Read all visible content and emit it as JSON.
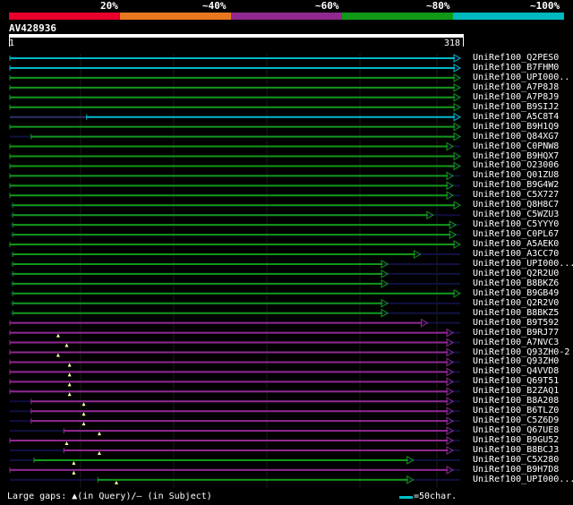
{
  "legend": {
    "labels": [
      "20%",
      "~40%",
      "~60%",
      "~80%",
      "~100%"
    ],
    "colors": [
      "#e8002a",
      "#e87820",
      "#902890",
      "#109818",
      "#00b8c0"
    ]
  },
  "query": {
    "id": "AV428936",
    "start": "1",
    "end": "318",
    "length": 318
  },
  "colors": {
    "cyan": "#00b8c8",
    "green": "#109818",
    "purple": "#902890",
    "navy": "#101040",
    "gap_marker": "#ffffa0"
  },
  "hits": [
    {
      "name": "UniRef100_Q2PES0",
      "color": "cyan",
      "start": 1,
      "end": 318,
      "arrow": true
    },
    {
      "name": "UniRef100_B7FHM0",
      "color": "cyan",
      "start": 1,
      "end": 318,
      "arrow": true
    },
    {
      "name": "UniRef100_UPI000..",
      "color": "green",
      "start": 1,
      "end": 318,
      "arrow": true
    },
    {
      "name": "UniRef100_A7P8J8",
      "color": "green",
      "start": 1,
      "end": 318,
      "arrow": true
    },
    {
      "name": "UniRef100_A7P8J9",
      "color": "green",
      "start": 1,
      "end": 318,
      "arrow": true
    },
    {
      "name": "UniRef100_B9SIJ2",
      "color": "green",
      "start": 1,
      "end": 318,
      "arrow": true
    },
    {
      "name": "UniRef100_A5C8T4",
      "color": "cyan",
      "start": 55,
      "end": 318,
      "arrow": true,
      "prefix": true
    },
    {
      "name": "UniRef100_B9H1Q9",
      "color": "green",
      "start": 1,
      "end": 318,
      "arrow": true
    },
    {
      "name": "UniRef100_Q84XG7",
      "color": "green",
      "start": 16,
      "end": 318,
      "arrow": true
    },
    {
      "name": "UniRef100_C0PNW8",
      "color": "green",
      "start": 1,
      "end": 313,
      "arrow": true
    },
    {
      "name": "UniRef100_B9HQX7",
      "color": "green",
      "start": 1,
      "end": 318,
      "arrow": true
    },
    {
      "name": "UniRef100_O23006",
      "color": "green",
      "start": 1,
      "end": 318,
      "arrow": true
    },
    {
      "name": "UniRef100_Q01ZU8",
      "color": "green",
      "start": 1,
      "end": 313,
      "arrow": true
    },
    {
      "name": "UniRef100_B9G4W2",
      "color": "green",
      "start": 1,
      "end": 313,
      "arrow": true
    },
    {
      "name": "UniRef100_C5X727",
      "color": "green",
      "start": 1,
      "end": 313,
      "arrow": true
    },
    {
      "name": "UniRef100_Q8H8C7",
      "color": "green",
      "start": 3,
      "end": 318,
      "arrow": true
    },
    {
      "name": "UniRef100_C5WZU3",
      "color": "green",
      "start": 3,
      "end": 299,
      "arrow": true
    },
    {
      "name": "UniRef100_C5YYY0",
      "color": "green",
      "start": 3,
      "end": 315,
      "arrow": true
    },
    {
      "name": "UniRef100_C0PL67",
      "color": "green",
      "start": 3,
      "end": 315,
      "arrow": true
    },
    {
      "name": "UniRef100_A5AEK0",
      "color": "green",
      "start": 1,
      "end": 318,
      "arrow": true
    },
    {
      "name": "UniRef100_A3CC70",
      "color": "green",
      "start": 3,
      "end": 290,
      "arrow": true
    },
    {
      "name": "UniRef100_UPI000...",
      "color": "green",
      "start": 3,
      "end": 267,
      "arrow": true
    },
    {
      "name": "UniRef100_Q2R2U0",
      "color": "green",
      "start": 3,
      "end": 267,
      "arrow": true
    },
    {
      "name": "UniRef100_B8BKZ6",
      "color": "green",
      "start": 3,
      "end": 267,
      "arrow": true
    },
    {
      "name": "UniRef100_B9GB49",
      "color": "green",
      "start": 3,
      "end": 318,
      "arrow": true
    },
    {
      "name": "UniRef100_Q2R2V0",
      "color": "green",
      "start": 3,
      "end": 267,
      "arrow": true
    },
    {
      "name": "UniRef100_B8BKZ5",
      "color": "green",
      "start": 3,
      "end": 267,
      "arrow": true
    },
    {
      "name": "UniRef100_B9T592",
      "color": "purple",
      "start": 1,
      "end": 295,
      "arrow": true
    },
    {
      "name": "UniRef100_B9RJ77",
      "color": "purple",
      "start": 1,
      "end": 313,
      "arrow": true,
      "gap": 35
    },
    {
      "name": "UniRef100_A7NVC3",
      "color": "purple",
      "start": 1,
      "end": 313,
      "arrow": true,
      "gap": 41
    },
    {
      "name": "UniRef100_Q93ZH0-2",
      "color": "purple",
      "start": 1,
      "end": 313,
      "arrow": true,
      "gap": 35
    },
    {
      "name": "UniRef100_Q93ZH0",
      "color": "purple",
      "start": 1,
      "end": 313,
      "arrow": true,
      "gap": 43
    },
    {
      "name": "UniRef100_Q4VVD8",
      "color": "purple",
      "start": 1,
      "end": 313,
      "arrow": true,
      "gap": 43
    },
    {
      "name": "UniRef100_Q69T51",
      "color": "purple",
      "start": 1,
      "end": 313,
      "arrow": true,
      "gap": 43
    },
    {
      "name": "UniRef100_B2ZAQ1",
      "color": "purple",
      "start": 1,
      "end": 313,
      "arrow": true,
      "gap": 43
    },
    {
      "name": "UniRef100_B8A208",
      "color": "purple",
      "start": 16,
      "end": 313,
      "arrow": true,
      "gap": 53
    },
    {
      "name": "UniRef100_B6TLZ0",
      "color": "purple",
      "start": 16,
      "end": 313,
      "arrow": true,
      "gap": 53
    },
    {
      "name": "UniRef100_C5Z6D9",
      "color": "purple",
      "start": 16,
      "end": 313,
      "arrow": true,
      "gap": 53
    },
    {
      "name": "UniRef100_Q67UE8",
      "color": "purple",
      "start": 39,
      "end": 313,
      "arrow": true,
      "gap": 64
    },
    {
      "name": "UniRef100_B9GU52",
      "color": "purple",
      "start": 1,
      "end": 313,
      "arrow": true,
      "gap": 41
    },
    {
      "name": "UniRef100_B8BCJ3",
      "color": "purple",
      "start": 39,
      "end": 313,
      "arrow": true,
      "gap": 64
    },
    {
      "name": "UniRef100_C5X280",
      "color": "green",
      "start": 18,
      "end": 285,
      "arrow": true,
      "gap": 46
    },
    {
      "name": "UniRef100_B9H7D8",
      "color": "purple",
      "start": 1,
      "end": 313,
      "arrow": true,
      "gap": 46
    },
    {
      "name": "UniRef100_UPI000...",
      "color": "green",
      "start": 63,
      "end": 285,
      "arrow": true,
      "gap": 76
    }
  ],
  "footer": {
    "text": "Large gaps: ▲(in Query)/– (in Subject)",
    "scale_text": "=50char."
  }
}
